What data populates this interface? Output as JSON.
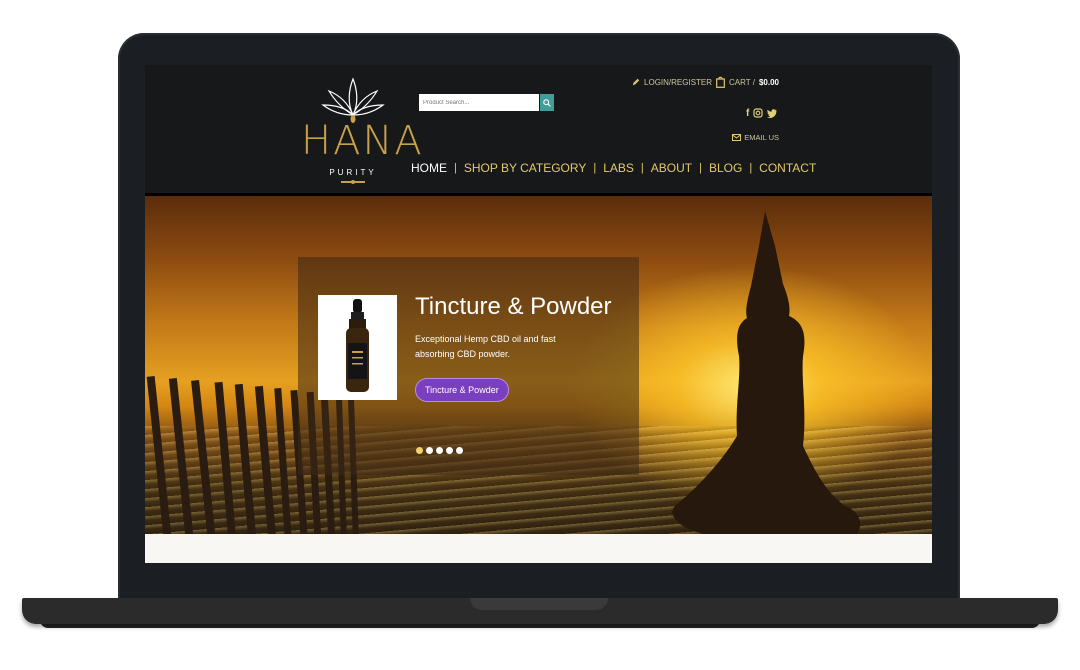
{
  "brand": {
    "name": "HANA",
    "tagline": "PURITY"
  },
  "search": {
    "placeholder": "Product Search..."
  },
  "header_links": {
    "login": "LOGIN/REGISTER",
    "cart_label": "CART /",
    "cart_total": "$0.00",
    "email": "EMAIL US"
  },
  "social": [
    "facebook-icon",
    "instagram-icon",
    "twitter-icon"
  ],
  "nav": {
    "items": [
      {
        "label": "HOME",
        "active": true
      },
      {
        "label": "SHOP BY CATEGORY"
      },
      {
        "label": "LABS"
      },
      {
        "label": "ABOUT"
      },
      {
        "label": "BLOG"
      },
      {
        "label": "CONTACT"
      }
    ],
    "separator": "|"
  },
  "slider": {
    "title": "Tincture & Powder",
    "description": "Exceptional Hemp CBD oil and fast absorbing CBD powder.",
    "button": "Tincture & Powder",
    "slide_count": 5,
    "active_slide": 1
  },
  "colors": {
    "accent_gold": "#e3c96a",
    "button_purple": "#7a3fbf",
    "search_button": "#3e9f9a",
    "header_bg": "#17181a"
  }
}
